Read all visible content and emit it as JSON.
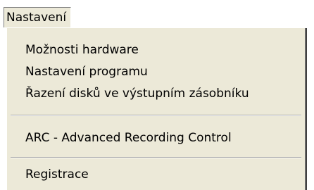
{
  "menubar": {
    "active_menu_label": "Nastavení"
  },
  "menu": {
    "items": [
      {
        "label": "Možnosti hardware"
      },
      {
        "label": "Nastavení programu"
      },
      {
        "label": "Řazení disků ve výstupním zásobníku"
      },
      {
        "label": "ARC - Advanced Recording Control"
      },
      {
        "label": "Registrace"
      }
    ]
  }
}
